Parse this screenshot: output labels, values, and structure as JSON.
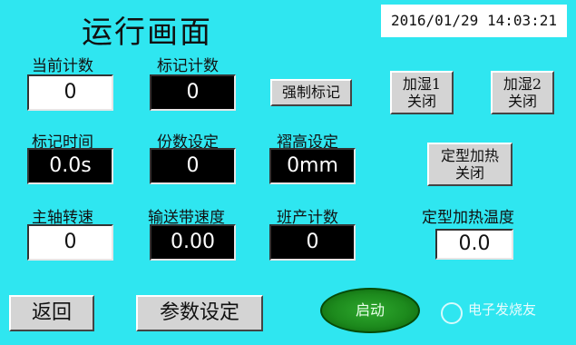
{
  "header": {
    "title": "运行画面",
    "datetime": "2016/01/29 14:03:21"
  },
  "labels": {
    "current_count": "当前计数",
    "mark_count": "标记计数",
    "mark_time": "标记时间",
    "portion_setting": "份数设定",
    "pleat_height_setting": "褶高设定",
    "spindle_speed": "主轴转速",
    "conveyor_speed": "输送带速度",
    "shift_count": "班产计数",
    "shaping_heat_temp": "定型加热温度"
  },
  "values": {
    "current_count": "0",
    "mark_count": "0",
    "mark_time": "0.0s",
    "portion_setting": "0",
    "pleat_height_setting": "0mm",
    "spindle_speed": "0",
    "conveyor_speed": "0.00",
    "shift_count": "0",
    "shaping_heat_temp": "0.0"
  },
  "buttons": {
    "force_mark": "强制标记",
    "humidify1_l1": "加湿1",
    "humidify1_l2": "关闭",
    "humidify2_l1": "加湿2",
    "humidify2_l2": "关闭",
    "shaping_heat_l1": "定型加热",
    "shaping_heat_l2": "关闭",
    "back": "返回",
    "param_settings": "参数设定",
    "start": "启动"
  },
  "watermark": {
    "text": "电子发烧友"
  },
  "colors": {
    "background": "#2fe6f0",
    "start_button": "#1d8a1d"
  }
}
